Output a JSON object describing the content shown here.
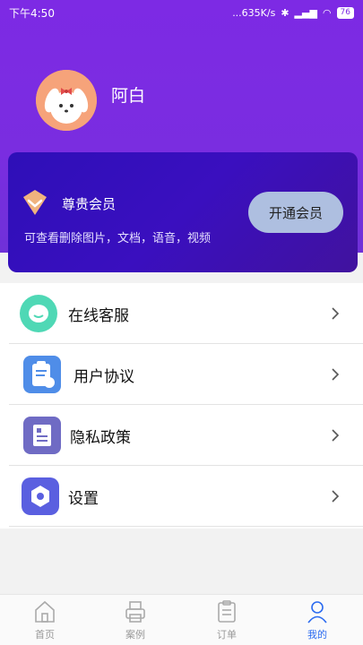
{
  "status_bar": {
    "time": "下午4:50",
    "network": "...635K/s",
    "battery": "76"
  },
  "profile": {
    "name": "阿白"
  },
  "vip": {
    "title": "尊贵会员",
    "description": "可查看删除图片，文档，语音，视频",
    "button_label": "开通会员"
  },
  "menu": {
    "items": [
      {
        "label": "在线客服",
        "icon": "chat-bubble-icon"
      },
      {
        "label": "用户协议",
        "icon": "clipboard-icon"
      },
      {
        "label": "隐私政策",
        "icon": "document-icon"
      },
      {
        "label": "设置",
        "icon": "settings-hex-icon"
      }
    ]
  },
  "tabbar": {
    "tabs": [
      {
        "label": "首页",
        "icon": "home-icon"
      },
      {
        "label": "案例",
        "icon": "printer-icon"
      },
      {
        "label": "订单",
        "icon": "clipboard-list-icon"
      },
      {
        "label": "我的",
        "icon": "person-icon",
        "active": true
      }
    ]
  },
  "colors": {
    "header": "#7d2ae4",
    "vip_card": "#3a0fbf",
    "active_tab": "#2b6bf0"
  }
}
